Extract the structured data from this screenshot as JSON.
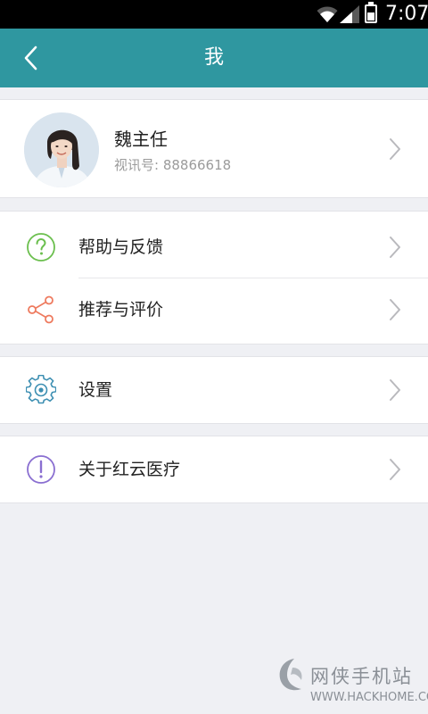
{
  "status_bar": {
    "time": "7:07",
    "battery_level": 0.55,
    "icons": [
      "wifi-icon",
      "signal-icon",
      "battery-icon"
    ]
  },
  "header": {
    "title": "我",
    "back_icon": "chevron-left-icon",
    "background": "#2f97a0"
  },
  "profile": {
    "name": "魏主任",
    "video_id": "视讯号: 88866618",
    "avatar": "doctor-avatar"
  },
  "menu": [
    {
      "label": "帮助与反馈",
      "icon": "help-question-icon",
      "icon_color": "#6bbf4e"
    },
    {
      "label": "推荐与评价",
      "icon": "share-icon",
      "icon_color": "#ee7a5e"
    },
    {
      "label": "设置",
      "icon": "gear-icon",
      "icon_color": "#3d8fb2"
    },
    {
      "label": "关于红云医疗",
      "icon": "info-exclamation-icon",
      "icon_color": "#8a6fd1"
    }
  ],
  "watermark": {
    "top": "网侠手机站",
    "bottom": "WWW.HACKHOME.COM"
  }
}
